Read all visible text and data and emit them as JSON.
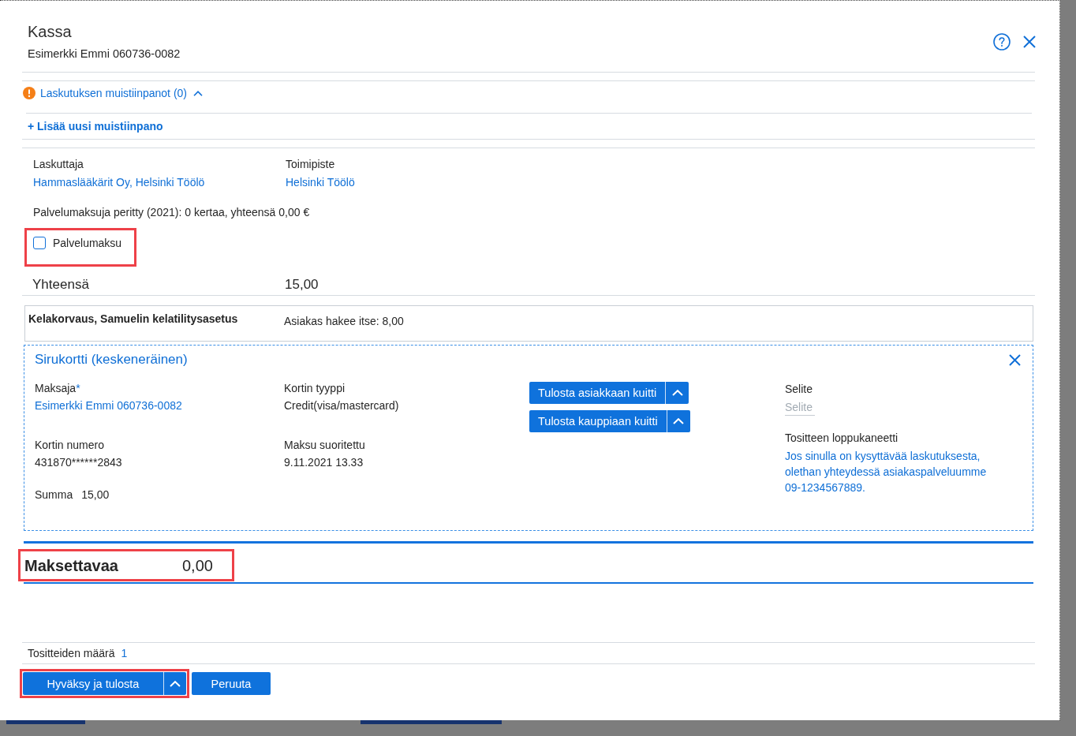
{
  "dialog": {
    "title": "Kassa",
    "subtitle": "Esimerkki Emmi 060736-0082"
  },
  "notes": {
    "label": "Laskutuksen muistiinpanot (0)",
    "expanded": true,
    "add_link": "+ Lisää uusi muistiinpano"
  },
  "billing": {
    "fields": [
      {
        "label": "Laskuttaja",
        "value": "Hammaslääkärit Oy, Helsinki Töölö"
      },
      {
        "label": "Toimipiste",
        "value": "Helsinki Töölö"
      }
    ],
    "service_fee_summary": "Palvelumaksuja peritty (2021): 0 kertaa, yhteensä 0,00 €"
  },
  "service_fee": {
    "label": "Palvelumaksu",
    "checked": false,
    "highlighted": true
  },
  "total": {
    "label": "Yhteensä",
    "value": "15,00"
  },
  "kela": {
    "title": "Kelakorvaus, Samuelin kelatilitysasetus",
    "note": "Asiakas hakee itse: 8,00"
  },
  "payment": {
    "title": "Sirukortti (keskeneräinen)",
    "fields": [
      {
        "label": "Maksaja",
        "required_mark": "*",
        "value": "Esimerkki Emmi 060736-0082",
        "kind": "link"
      },
      {
        "label": "Kortin tyyppi",
        "value": "Credit(visa/mastercard)",
        "kind": "text"
      },
      {
        "label": "Kortin numero",
        "value": "431870******2843",
        "kind": "text"
      },
      {
        "label": "Maksu suoritettu",
        "value": "9.11.2021 13.33",
        "kind": "text"
      }
    ],
    "sum": {
      "label": "Summa",
      "value": "15,00"
    },
    "print_buttons": [
      {
        "label": "Tulosta asiakkaan kuitti"
      },
      {
        "label": "Tulosta kauppiaan kuitti"
      }
    ],
    "description": {
      "label": "Selite",
      "placeholder": "Selite"
    },
    "closing_note": {
      "label": "Tositteen loppukaneetti",
      "text": "Jos sinulla on kysyttävää laskutuksesta, olethan yhteydessä asiakaspalveluumme 09-1234567889."
    }
  },
  "amount_due": {
    "label": "Maksettavaa",
    "value": "0,00",
    "highlighted": true
  },
  "receipt_count": {
    "label": "Tositteiden määrä",
    "value": "1"
  },
  "actions": [
    {
      "label": "Hyväksy ja tulosta",
      "kind": "split",
      "highlighted": true
    },
    {
      "label": "Peruuta",
      "kind": "plain",
      "highlighted": false
    }
  ]
}
